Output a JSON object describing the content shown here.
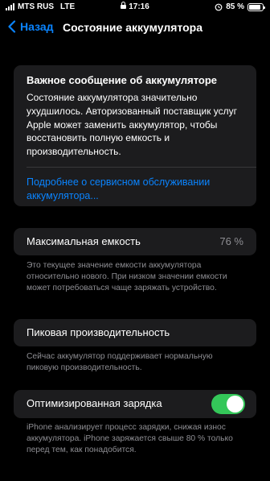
{
  "status_bar": {
    "carrier": "MTS RUS",
    "network": "LTE",
    "time": "17:16",
    "battery_text": "85 %",
    "battery_level": 0.85
  },
  "nav": {
    "back_label": "Назад",
    "title": "Состояние аккумулятора"
  },
  "message": {
    "title": "Важное сообщение об аккумуляторе",
    "body": "Состояние аккумулятора значительно ухудшилось. Авторизованный поставщик услуг Apple может заменить аккумулятор, чтобы восстановить полную емкость и производительность.",
    "link": "Подробнее о сервисном обслуживании аккумулятора..."
  },
  "max_capacity": {
    "label": "Максимальная емкость",
    "value": "76 %",
    "footnote": "Это текущее значение емкости аккумулятора относительно нового. При низком значении емкости может потребоваться чаще заряжать устройство."
  },
  "peak_performance": {
    "label": "Пиковая производительность",
    "footnote": "Сейчас аккумулятор поддерживает нормальную пиковую производительность."
  },
  "optimized_charging": {
    "label": "Оптимизированная зарядка",
    "enabled": true,
    "footnote": "iPhone анализирует процесс зарядки, снижая износ аккумулятора. iPhone заряжается свыше 80 % только перед тем, как понадобится."
  },
  "colors": {
    "accent": "#0a84ff",
    "toggle_on": "#34c759",
    "card_bg": "#1c1c1e",
    "secondary_text": "#8e8e93"
  }
}
